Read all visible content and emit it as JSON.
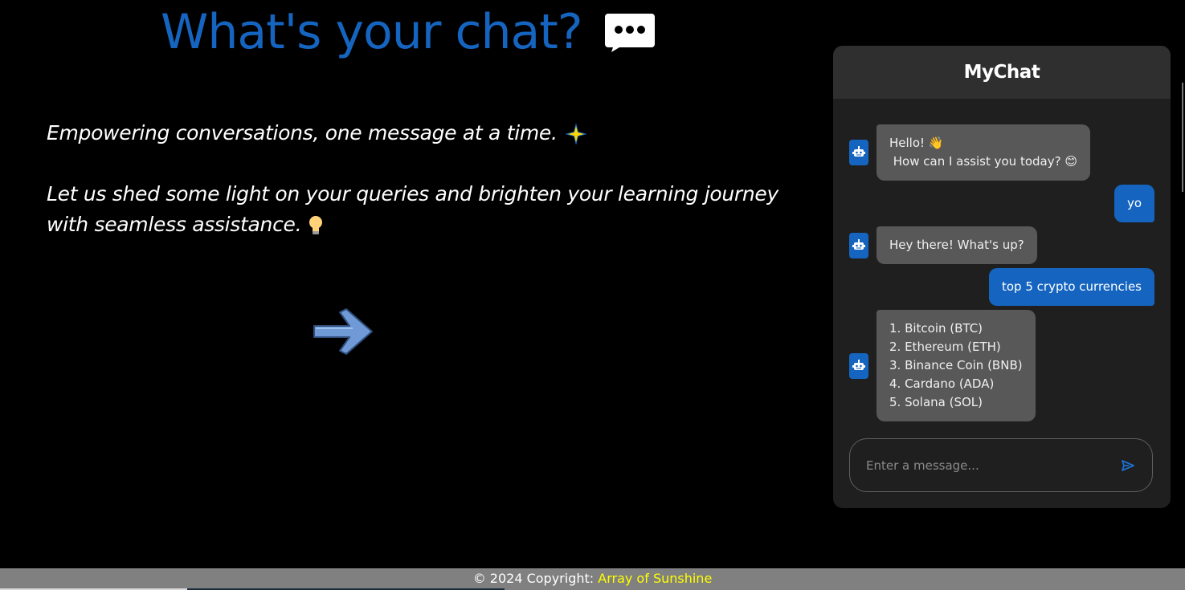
{
  "hero": {
    "title": "What's your chat?",
    "icon": "chat-bubble-icon"
  },
  "taglines": {
    "line1": "Empowering conversations, one message at a time.",
    "line1_icon": "sparkle-icon",
    "line2": "Let us shed some light on your queries and brighten your learning journey with seamless assistance.",
    "line2_icon": "lightbulb-icon"
  },
  "arrow_icon": "right-arrow-icon",
  "chat": {
    "title": "MyChat",
    "bot_icon": "robot-icon",
    "messages": [
      {
        "role": "bot",
        "lines": [
          "Hello! 👋",
          " How can I assist you today? 😊"
        ]
      },
      {
        "role": "user",
        "lines": [
          "yo"
        ]
      },
      {
        "role": "bot",
        "lines": [
          "Hey there! What's up?"
        ]
      },
      {
        "role": "user",
        "lines": [
          "top 5 crypto currencies"
        ]
      },
      {
        "role": "bot",
        "lines": [
          "1. Bitcoin (BTC)",
          "2. Ethereum (ETH)",
          "3. Binance Coin (BNB)",
          "4. Cardano (ADA)",
          "5. Solana (SOL)"
        ]
      }
    ],
    "input": {
      "placeholder": "Enter a message...",
      "value": ""
    },
    "send_icon": "send-icon"
  },
  "footer": {
    "prefix": "© 2024 Copyright: ",
    "link": "Array of Sunshine"
  },
  "colors": {
    "accent": "#1565c0",
    "background": "#000000",
    "widget": "#1f1f1f",
    "header": "#2f2f2f",
    "bot_bubble": "#585858",
    "footer": "#808080",
    "footer_link": "#ffff00"
  }
}
